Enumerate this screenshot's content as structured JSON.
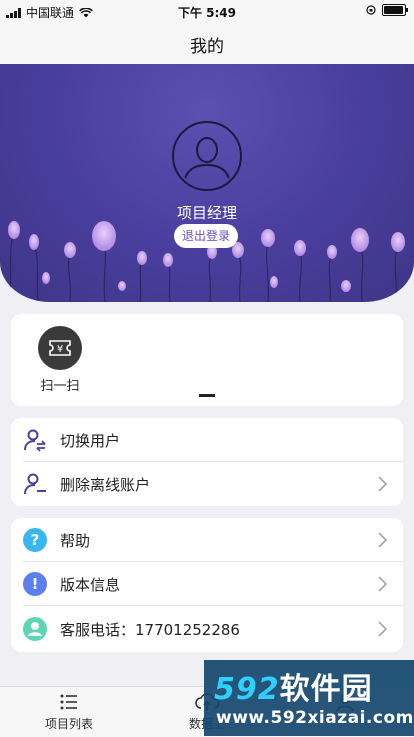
{
  "status_bar": {
    "carrier": "中国联通",
    "time": "下午 5:49"
  },
  "nav": {
    "title": "我的"
  },
  "profile": {
    "role": "项目经理",
    "logout_label": "退出登录"
  },
  "quick_actions": [
    {
      "label": "扫一扫",
      "icon": "scan-ticket-icon"
    }
  ],
  "account_menu": [
    {
      "label": "切换用户",
      "icon": "switch-user-icon",
      "has_arrow": false
    },
    {
      "label": "删除离线账户",
      "icon": "remove-user-icon",
      "has_arrow": true
    }
  ],
  "info_menu": [
    {
      "label": "帮助",
      "icon": "help-icon",
      "color": "#3ab7f0",
      "has_arrow": true
    },
    {
      "label": "版本信息",
      "icon": "info-icon",
      "color": "#5b7ff0",
      "has_arrow": true
    },
    {
      "label": "客服电话：17701252286",
      "icon": "service-icon",
      "color": "#5ed6b4",
      "has_arrow": true
    }
  ],
  "tab_bar": [
    {
      "label": "项目列表",
      "icon": "list-icon"
    },
    {
      "label": "数据上",
      "icon": "cloud-upload-icon"
    },
    {
      "label": "",
      "icon": "profile-tab-icon"
    }
  ],
  "watermark": {
    "brand_digits": "592",
    "brand_text": "软件园",
    "url": "www.592xiazai.com"
  },
  "colors": {
    "accent": "#4a3f9e",
    "link": "#6a4fc8",
    "icon_purple": "#4b3fa0"
  }
}
